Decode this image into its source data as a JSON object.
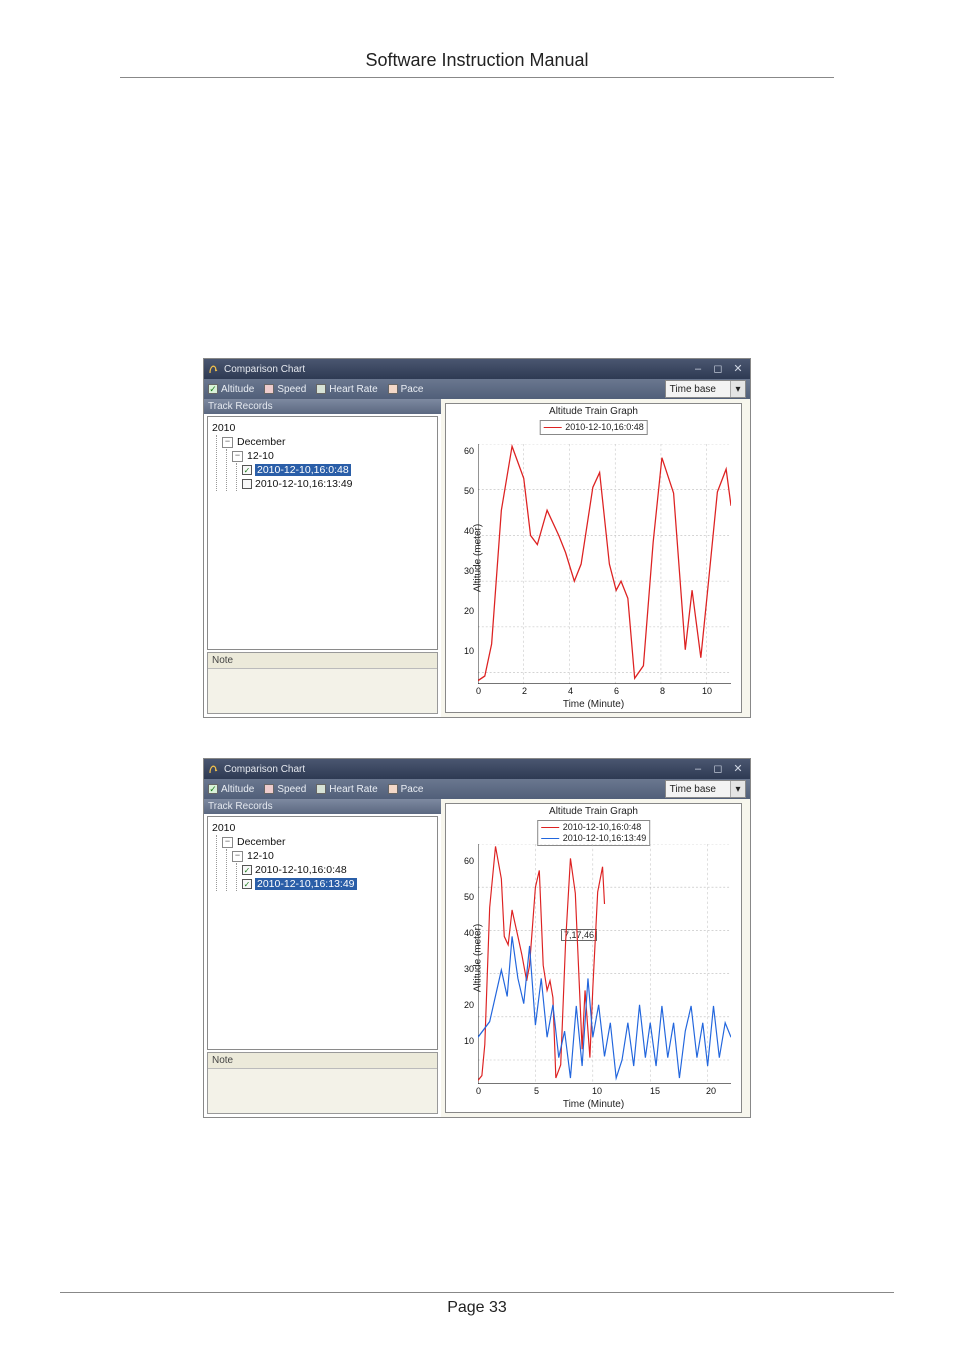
{
  "doc": {
    "header": "Software Instruction Manual",
    "footer": "Page 33"
  },
  "window_title": "Comparison Chart",
  "toolbar": {
    "altitude": "Altitude",
    "speed": "Speed",
    "heart_rate": "Heart Rate",
    "pace": "Pace",
    "time_base": "Time base"
  },
  "sidebar": {
    "records_header": "Track Records",
    "note_header": "Note",
    "year": "2010",
    "month": "December",
    "day": "12-10",
    "track_a": "2010-12-10,16:0:48",
    "track_b": "2010-12-10,16:13:49"
  },
  "chart": {
    "title": "Altitude Train Graph",
    "ylabel": "Altitude (meter)",
    "xlabel": "Time (Minute)",
    "legend_a": "2010-12-10,16:0:48",
    "legend_b": "2010-12-10,16:13:49",
    "callout": "7,17,46",
    "y_60": "60",
    "y_50": "50",
    "y_40": "40",
    "y_30": "30",
    "y_20": "20",
    "y_10": "10"
  },
  "xticks_a": {
    "0": "0",
    "2": "2",
    "4": "4",
    "6": "6",
    "8": "8",
    "10": "10"
  },
  "xticks_b": {
    "0": "0",
    "5": "5",
    "10": "10",
    "15": "15",
    "20": "20"
  },
  "chart_data": [
    {
      "type": "line",
      "title": "Altitude Train Graph",
      "xlabel": "Time (Minute)",
      "ylabel": "Altitude (meter)",
      "xlim": [
        0,
        11
      ],
      "ylim": [
        10,
        65
      ],
      "series": [
        {
          "name": "2010-12-10,16:0:48",
          "color": "#d22",
          "x": [
            0.0,
            0.3,
            0.6,
            1.0,
            1.5,
            2.0,
            2.3,
            2.6,
            3.0,
            3.5,
            3.8,
            4.2,
            4.5,
            5.0,
            5.3,
            5.7,
            6.0,
            6.2,
            6.5,
            6.8,
            7.2,
            7.6,
            8.0,
            8.5,
            9.0,
            9.3,
            9.7,
            10.0,
            10.4,
            10.8,
            11.0
          ],
          "values": [
            10,
            12,
            20,
            48,
            63,
            55,
            42,
            40,
            48,
            42,
            38,
            32,
            36,
            53,
            57,
            36,
            30,
            32,
            28,
            10,
            13,
            40,
            58,
            50,
            16,
            30,
            14,
            30,
            50,
            55,
            46
          ]
        }
      ]
    },
    {
      "type": "line",
      "title": "Altitude Train Graph",
      "xlabel": "Time (Minute)",
      "ylabel": "Altitude (meter)",
      "xlim": [
        0,
        22
      ],
      "ylim": [
        5,
        65
      ],
      "annotation": {
        "x": 7,
        "y": 17.46,
        "text": "7,17,46"
      },
      "series": [
        {
          "name": "2010-12-10,16:0:48",
          "color": "#d22",
          "x": [
            0.0,
            0.3,
            0.6,
            1.0,
            1.5,
            2.0,
            2.3,
            2.6,
            3.0,
            3.5,
            3.8,
            4.2,
            4.5,
            5.0,
            5.3,
            5.7,
            6.0,
            6.2,
            6.5,
            6.8,
            7.2,
            7.6,
            8.0,
            8.5,
            9.0,
            9.3,
            9.7,
            10.0,
            10.4,
            10.8,
            11.0
          ],
          "values": [
            10,
            12,
            20,
            48,
            63,
            55,
            42,
            40,
            48,
            42,
            38,
            32,
            36,
            53,
            57,
            36,
            30,
            32,
            28,
            10,
            13,
            40,
            58,
            50,
            16,
            30,
            14,
            30,
            50,
            55,
            46
          ]
        },
        {
          "name": "2010-12-10,16:13:49",
          "color": "#26d",
          "x": [
            0,
            1,
            2,
            2.5,
            3,
            3.5,
            4,
            4.5,
            5,
            5.5,
            6,
            6.5,
            7,
            7.5,
            8,
            8.5,
            9,
            9.5,
            10,
            10.5,
            11,
            11.5,
            12,
            12.5,
            13,
            13.5,
            14,
            14.5,
            15,
            15.5,
            16,
            16.5,
            17,
            17.5,
            18,
            18.5,
            19,
            19.5,
            20,
            20.5,
            21,
            21.5,
            22
          ],
          "values": [
            18,
            22,
            34,
            28,
            42,
            30,
            24,
            38,
            22,
            30,
            18,
            26,
            14,
            20,
            10,
            24,
            12,
            30,
            18,
            26,
            14,
            22,
            10,
            14,
            22,
            12,
            26,
            14,
            22,
            12,
            24,
            14,
            22,
            10,
            20,
            24,
            14,
            22,
            12,
            24,
            14,
            22,
            18
          ]
        }
      ]
    }
  ]
}
